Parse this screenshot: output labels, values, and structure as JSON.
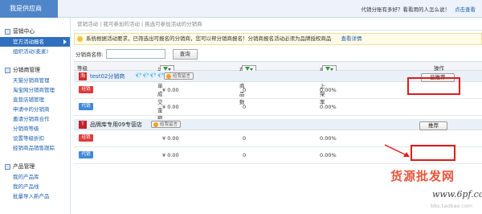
{
  "header": {
    "brand": "我是供应商",
    "notice_text": "代销分账有多好？看看用的人怎么说！",
    "notice_link": "点击查看"
  },
  "sidebar": {
    "groups": [
      {
        "title": "营销中心",
        "items": [
          "官方活动报名",
          "组织活动(麦麦)"
        ]
      },
      {
        "title": "分销商管理",
        "items": [
          "天猫分销商管理",
          "淘宝网分销商管理",
          "直营店铺管理",
          "申请中的分销商",
          "邀请分销商合作",
          "分销商等级",
          "设置等级折扣",
          "经销商品销售跟踪"
        ]
      },
      {
        "title": "产品管理",
        "items": [
          "我的产品库",
          "我的产品线",
          "批量导入新产品"
        ]
      }
    ]
  },
  "main": {
    "breadcrumb": "营销活动 | 我可参加的活动 | 挑选可参加活动的分销商",
    "notice": "系统根据活动要求，已筛选出可报名的分销商，您可以帮分销商报名！分销商报名活动必须为品牌授权商品",
    "notice_link": "查看详情",
    "search_label": "分销商名称:",
    "search_value": "",
    "search_button": "查询",
    "columns": {
      "level": "等级",
      "amount": "采购单成交金额",
      "count": "在售商品数",
      "newitems": "商品上架率",
      "op": "操作"
    },
    "shops": [
      {
        "icon": "淘",
        "name": "test02分销商",
        "diamonds": "💎💎💎💎💎",
        "contact": "给我留言",
        "action": "已推荐",
        "rows": [
          {
            "tag": "经销",
            "amount": "¥ 0.00",
            "count": "0",
            "rate": "0.00%"
          },
          {
            "tag": "代销",
            "amount": "¥ 0.00",
            "count": "0",
            "rate": "0.00%"
          }
        ]
      },
      {
        "icon": "T",
        "name": "品牌库专用09专营店",
        "diamonds": "",
        "contact": "给我留言",
        "action": "推荐",
        "rows": [
          {
            "tag": "经销",
            "amount": "¥ 0.00",
            "count": "0",
            "rate": "0.00%"
          },
          {
            "tag": "代销",
            "amount": "¥ 0.00",
            "count": "0",
            "rate": "0.00%"
          }
        ]
      }
    ]
  },
  "watermark": {
    "line1": "货源批发网",
    "line2": "www.6pf.com",
    "line3": "bbs.taobao.com"
  },
  "colors": {
    "accent": "#2f6fbf",
    "highlight": "#e01b1b"
  }
}
